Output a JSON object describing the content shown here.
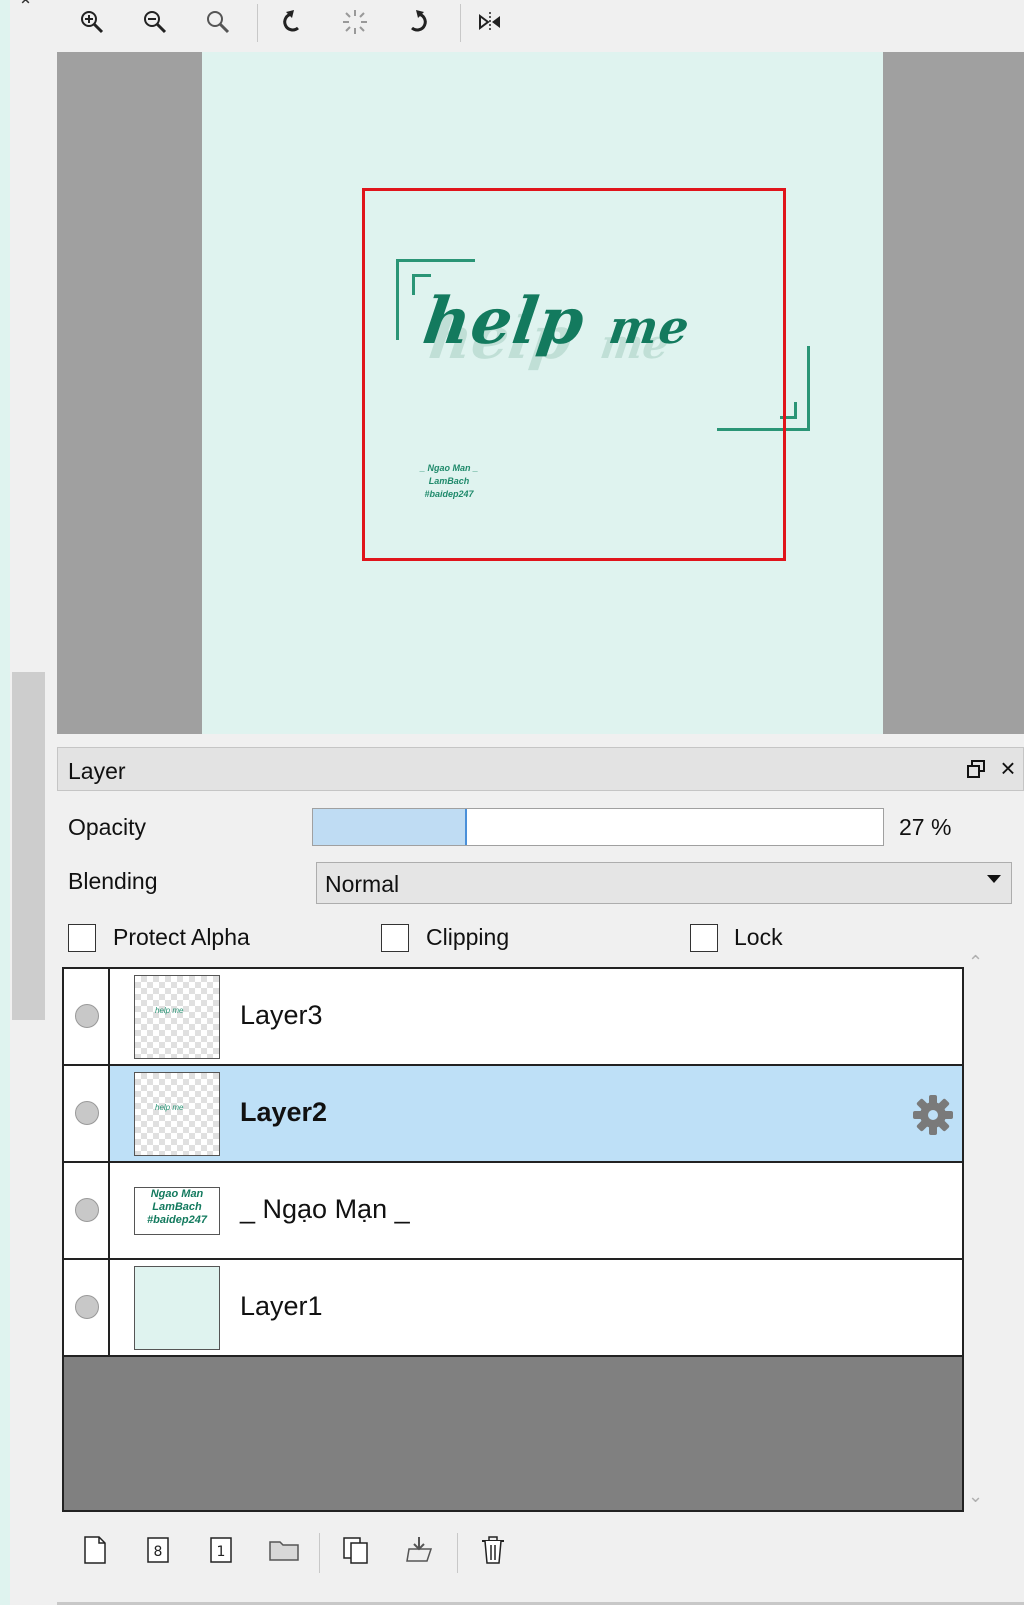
{
  "toolbar": {
    "buttons": [
      {
        "icon": "zoom-in-icon"
      },
      {
        "icon": "zoom-out-icon"
      },
      {
        "icon": "zoom-reset-icon"
      },
      {
        "icon": "rotate-left-icon"
      },
      {
        "icon": "rotate-reset-icon"
      },
      {
        "icon": "rotate-right-icon"
      },
      {
        "icon": "flip-horizontal-icon"
      }
    ]
  },
  "canvas": {
    "artwork_title_word1": "help",
    "artwork_title_word2": "me",
    "artwork_credit_line1": "_ Ngao Man _",
    "artwork_credit_line2": "LamBach",
    "artwork_credit_line3": "#baidep247",
    "selection_color": "#e0141b",
    "background_color": "#dff3ef",
    "ink_color": "#137a5e"
  },
  "layer_panel": {
    "title": "Layer",
    "opacity_label": "Opacity",
    "opacity_value": 27,
    "opacity_text": "27 %",
    "blending_label": "Blending",
    "blending_value": "Normal",
    "protect_alpha_label": "Protect Alpha",
    "clipping_label": "Clipping",
    "lock_label": "Lock",
    "layers": [
      {
        "name": "Layer3",
        "selected": false
      },
      {
        "name": "Layer2",
        "selected": true
      },
      {
        "name": "_ Ngạo Mạn _",
        "selected": false,
        "thumb_text_1": "Ngao Man",
        "thumb_text_2": "LamBach",
        "thumb_text_3": "#baidep247"
      },
      {
        "name": "Layer1",
        "selected": false
      }
    ],
    "thumb_text_layer3": "help me",
    "thumb_text_layer2": "help me",
    "bottom_tools": [
      {
        "icon": "new-layer-icon"
      },
      {
        "icon": "new-8bit-layer-icon"
      },
      {
        "icon": "new-1bit-layer-icon"
      },
      {
        "icon": "new-folder-icon"
      },
      {
        "icon": "duplicate-layer-icon"
      },
      {
        "icon": "merge-down-icon"
      },
      {
        "icon": "delete-layer-icon"
      }
    ],
    "selected_row_color": "#bee0f7"
  }
}
